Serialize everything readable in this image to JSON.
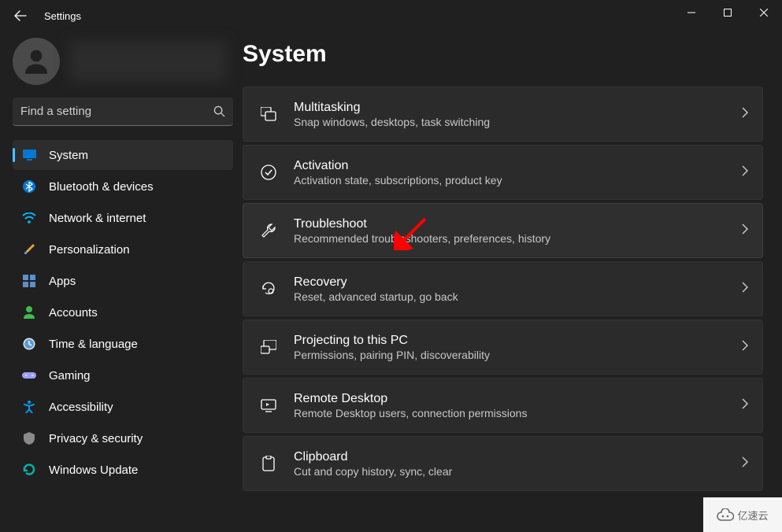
{
  "window": {
    "title": "Settings"
  },
  "search": {
    "placeholder": "Find a setting"
  },
  "sidebar": {
    "items": [
      {
        "label": "System",
        "icon": "monitor",
        "color": "#0078d4",
        "active": true
      },
      {
        "label": "Bluetooth & devices",
        "icon": "bluetooth",
        "color": "#0078d4"
      },
      {
        "label": "Network & internet",
        "icon": "wifi",
        "color": "#00b7ff"
      },
      {
        "label": "Personalization",
        "icon": "brush",
        "color": "#e8a33d"
      },
      {
        "label": "Apps",
        "icon": "apps",
        "color": "#5b90c9"
      },
      {
        "label": "Accounts",
        "icon": "person",
        "color": "#3fb950"
      },
      {
        "label": "Time & language",
        "icon": "clock",
        "color": "#5b9bd5"
      },
      {
        "label": "Gaming",
        "icon": "gamepad",
        "color": "#9aa0ff"
      },
      {
        "label": "Accessibility",
        "icon": "accessibility",
        "color": "#0099e6"
      },
      {
        "label": "Privacy & security",
        "icon": "shield",
        "color": "#8a8a8a"
      },
      {
        "label": "Windows Update",
        "icon": "update",
        "color": "#00b2a9"
      }
    ]
  },
  "main": {
    "heading": "System",
    "items": [
      {
        "title": "Multitasking",
        "desc": "Snap windows, desktops, task switching",
        "icon": "multitask"
      },
      {
        "title": "Activation",
        "desc": "Activation state, subscriptions, product key",
        "icon": "check"
      },
      {
        "title": "Troubleshoot",
        "desc": "Recommended troubleshooters, preferences, history",
        "icon": "wrench",
        "highlighted": true
      },
      {
        "title": "Recovery",
        "desc": "Reset, advanced startup, go back",
        "icon": "recovery"
      },
      {
        "title": "Projecting to this PC",
        "desc": "Permissions, pairing PIN, discoverability",
        "icon": "project"
      },
      {
        "title": "Remote Desktop",
        "desc": "Remote Desktop users, connection permissions",
        "icon": "remote"
      },
      {
        "title": "Clipboard",
        "desc": "Cut and copy history, sync, clear",
        "icon": "clipboard"
      }
    ]
  },
  "watermark": {
    "text": "亿速云"
  }
}
